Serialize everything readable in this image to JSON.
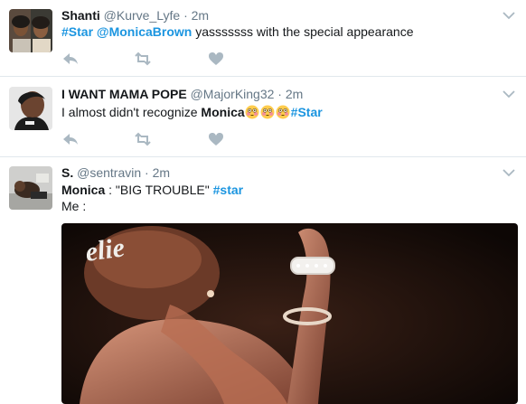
{
  "tweets": [
    {
      "name": "Shanti",
      "handle": "@Kurve_Lyfe",
      "separator": "·",
      "time": "2m",
      "text_parts": [
        "#Star",
        "@MonicaBrown",
        "yasssssss with the special appearance"
      ]
    },
    {
      "name": "I WANT MAMA POPE",
      "handle": "@MajorKing32",
      "separator": "·",
      "time": "2m",
      "text_parts": [
        "I almost didn't recognize",
        "Monica",
        "#Star"
      ]
    },
    {
      "name": "S.",
      "handle": "@sentravin",
      "separator": "·",
      "time": "2m",
      "line1_parts": [
        "Monica",
        ": \"BIG TROUBLE\"",
        "#star"
      ],
      "line2": "Me :",
      "media_caption": "elie"
    }
  ],
  "icons": [
    "reply-icon",
    "retweet-icon",
    "like-icon",
    "caret-down-icon",
    "flushed-face-emoji"
  ],
  "colors": {
    "link": "#1b95e0",
    "meta": "#657786",
    "icon": "#aab8c2",
    "divider": "#e1e8ed"
  }
}
